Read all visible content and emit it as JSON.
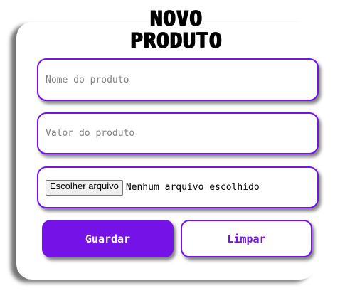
{
  "form": {
    "title_line1": "NOVO",
    "title_line2": "PRODUTO",
    "name_placeholder": "Nome do produto",
    "price_placeholder": "Valor do produto",
    "file_button_label": "Escolher arquivo",
    "file_status": "Nenhum arquivo escolhido",
    "save_label": "Guardar",
    "clear_label": "Limpar"
  },
  "colors": {
    "accent": "#7412e8",
    "background": "#ffffff",
    "text": "#000000",
    "placeholder": "#808080"
  }
}
